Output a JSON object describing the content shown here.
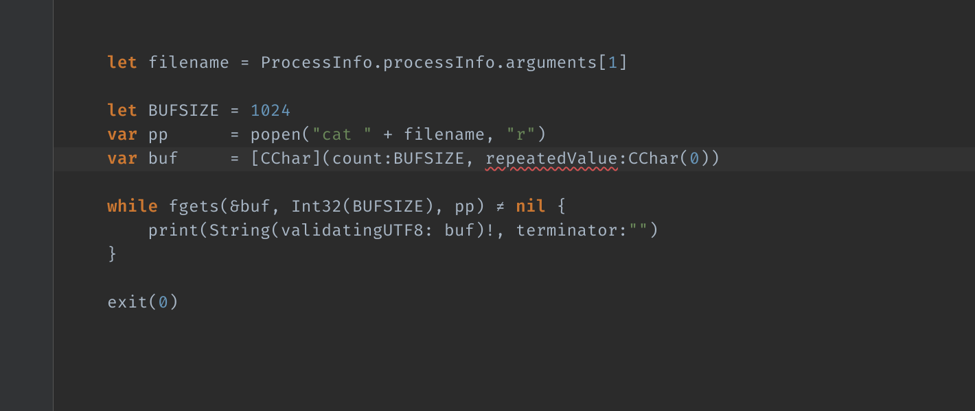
{
  "editor": {
    "highlighted_line_index": 5,
    "line_height": 35,
    "top_padding": 75,
    "code_lines": [
      [
        {
          "t": "let",
          "c": "kw"
        },
        {
          "t": " filename ",
          "c": "plain"
        },
        {
          "t": "=",
          "c": "op"
        },
        {
          "t": " ProcessInfo",
          "c": "type"
        },
        {
          "t": ".",
          "c": "op"
        },
        {
          "t": "processInfo",
          "c": "ident"
        },
        {
          "t": ".",
          "c": "op"
        },
        {
          "t": "arguments",
          "c": "ident"
        },
        {
          "t": "[",
          "c": "op"
        },
        {
          "t": "1",
          "c": "num"
        },
        {
          "t": "]",
          "c": "op"
        }
      ],
      [],
      [
        {
          "t": "let",
          "c": "kw"
        },
        {
          "t": " BUFSIZE ",
          "c": "plain"
        },
        {
          "t": "=",
          "c": "op"
        },
        {
          "t": " ",
          "c": "plain"
        },
        {
          "t": "1024",
          "c": "num"
        }
      ],
      [
        {
          "t": "var",
          "c": "kw"
        },
        {
          "t": " pp      ",
          "c": "plain"
        },
        {
          "t": "=",
          "c": "op"
        },
        {
          "t": " popen(",
          "c": "plain"
        },
        {
          "t": "\"cat \"",
          "c": "string"
        },
        {
          "t": " ",
          "c": "plain"
        },
        {
          "t": "+",
          "c": "op"
        },
        {
          "t": " filename",
          "c": "ident"
        },
        {
          "t": ",",
          "c": "op"
        },
        {
          "t": " ",
          "c": "plain"
        },
        {
          "t": "\"r\"",
          "c": "string"
        },
        {
          "t": ")",
          "c": "op"
        }
      ],
      [
        {
          "t": "var",
          "c": "kw"
        },
        {
          "t": " buf     ",
          "c": "plain"
        },
        {
          "t": "=",
          "c": "op"
        },
        {
          "t": " [CChar](count:BUFSIZE",
          "c": "plain"
        },
        {
          "t": ",",
          "c": "op"
        },
        {
          "t": " ",
          "c": "plain"
        },
        {
          "t": "repeatedValue",
          "c": "err"
        },
        {
          "t": ":CChar(",
          "c": "plain"
        },
        {
          "t": "0",
          "c": "num"
        },
        {
          "t": "))",
          "c": "op"
        }
      ],
      [],
      [
        {
          "t": "while",
          "c": "kw"
        },
        {
          "t": " fgets(",
          "c": "plain"
        },
        {
          "t": "&",
          "c": "op"
        },
        {
          "t": "buf",
          "c": "ident"
        },
        {
          "t": ",",
          "c": "op"
        },
        {
          "t": " Int32(BUFSIZE)",
          "c": "plain"
        },
        {
          "t": ",",
          "c": "op"
        },
        {
          "t": " pp) ",
          "c": "plain"
        },
        {
          "t": "≠",
          "c": "op"
        },
        {
          "t": " ",
          "c": "plain"
        },
        {
          "t": "nil",
          "c": "kw"
        },
        {
          "t": " {",
          "c": "op"
        }
      ],
      [
        {
          "t": "    print(String(validatingUTF8: buf)",
          "c": "plain"
        },
        {
          "t": "!",
          "c": "op"
        },
        {
          "t": ",",
          "c": "op"
        },
        {
          "t": " terminator:",
          "c": "plain"
        },
        {
          "t": "\"\"",
          "c": "string"
        },
        {
          "t": ")",
          "c": "op"
        }
      ],
      [
        {
          "t": "}",
          "c": "op"
        }
      ],
      [],
      [
        {
          "t": "exit(",
          "c": "plain"
        },
        {
          "t": "0",
          "c": "num"
        },
        {
          "t": ")",
          "c": "op"
        }
      ]
    ]
  }
}
